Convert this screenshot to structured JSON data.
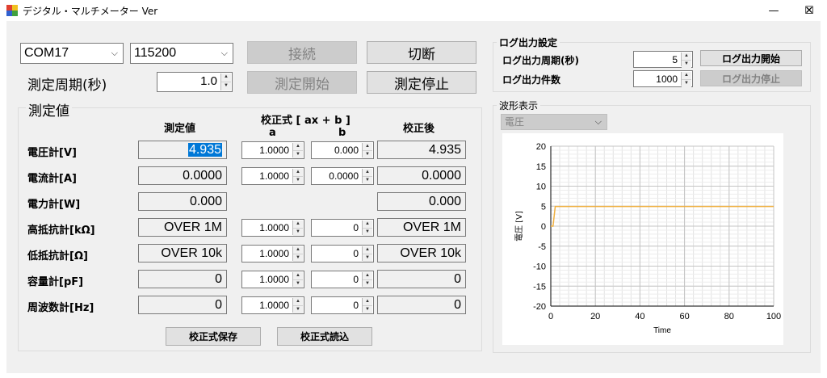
{
  "window": {
    "title": "デジタル・マルチメーター Ver",
    "minimize_glyph": "—",
    "maximize_glyph": "☐",
    "close_glyph": "✕"
  },
  "connection": {
    "port": "COM17",
    "baud": "115200",
    "connect_label": "接続",
    "disconnect_label": "切断",
    "interval_label": "測定周期(秒)",
    "interval_value": "1.0",
    "start_label": "測定開始",
    "stop_label": "測定停止"
  },
  "measure": {
    "group_title": "測定値",
    "col_value": "測定値",
    "col_formula": "校正式 [ ax + b ]",
    "col_a": "a",
    "col_b": "b",
    "col_corrected": "校正後",
    "rows": [
      {
        "label": "電圧計[V]",
        "value": "4.935",
        "a": "1.0000",
        "b": "0.000",
        "corrected": "4.935"
      },
      {
        "label": "電流計[A]",
        "value": "0.0000",
        "a": "1.0000",
        "b": "0.0000",
        "corrected": "0.0000"
      },
      {
        "label": "電力計[W]",
        "value": "0.000",
        "a": "",
        "b": "",
        "corrected": "0.000"
      },
      {
        "label": "高抵抗計[kΩ]",
        "value": "OVER 1M",
        "a": "1.0000",
        "b": "0",
        "corrected": "OVER 1M"
      },
      {
        "label": "低抵抗計[Ω]",
        "value": "OVER 10k",
        "a": "1.0000",
        "b": "0",
        "corrected": "OVER 10k"
      },
      {
        "label": "容量計[pF]",
        "value": "0",
        "a": "1.0000",
        "b": "0",
        "corrected": "0"
      },
      {
        "label": "周波数計[Hz]",
        "value": "0",
        "a": "1.0000",
        "b": "0",
        "corrected": "0"
      }
    ],
    "save_label": "校正式保存",
    "load_label": "校正式読込"
  },
  "log": {
    "group_title": "ログ出力設定",
    "period_label": "ログ出力周期(秒)",
    "period_value": "5",
    "count_label": "ログ出力件数",
    "count_value": "1000",
    "start_label": "ログ出力開始",
    "stop_label": "ログ出力停止"
  },
  "waveform": {
    "group_title": "波形表示",
    "selected": "電圧"
  },
  "chart_data": {
    "type": "line",
    "xlabel": "Time",
    "ylabel": "電圧 [V]",
    "xlim": [
      0,
      100
    ],
    "ylim": [
      -20,
      20
    ],
    "xticks": [
      0,
      20,
      40,
      60,
      80,
      100
    ],
    "yticks": [
      -20,
      -15,
      -10,
      -5,
      0,
      5,
      10,
      15,
      20
    ],
    "grid": true,
    "line_color": "#f0b040",
    "series": [
      {
        "x": [
          0,
          1,
          2,
          100
        ],
        "y": [
          0,
          0,
          4.935,
          4.935
        ]
      }
    ]
  }
}
